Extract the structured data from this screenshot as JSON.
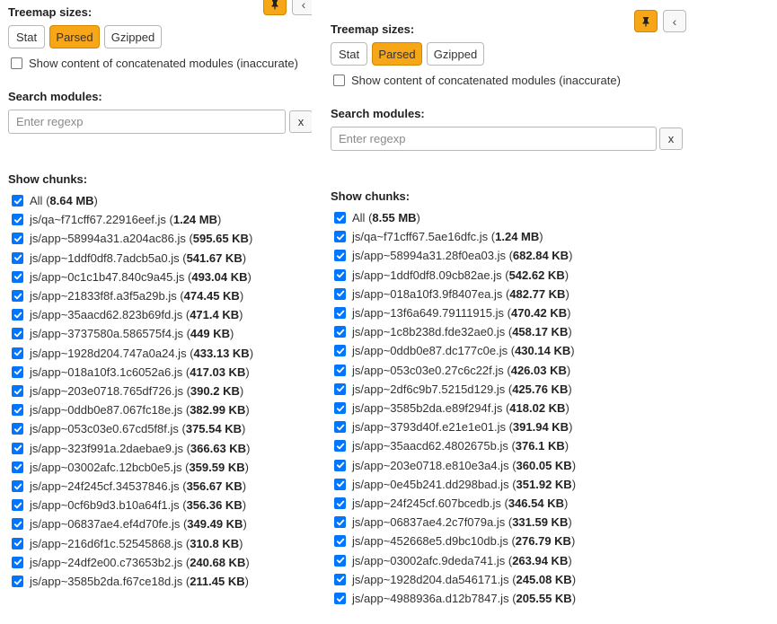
{
  "left": {
    "treemap_title": "Treemap sizes:",
    "size_buttons": [
      {
        "label": "Stat",
        "active": false
      },
      {
        "label": "Parsed",
        "active": true
      },
      {
        "label": "Gzipped",
        "active": false
      }
    ],
    "concat_label": "Show content of concatenated modules (inaccurate)",
    "search_title": "Search modules:",
    "search_placeholder": "Enter regexp",
    "clear_label": "x",
    "chunks_title": "Show chunks:",
    "chunks": [
      {
        "name": "All",
        "size": "8.64 MB"
      },
      {
        "name": "js/qa~f71cff67.22916eef.js",
        "size": "1.24 MB"
      },
      {
        "name": "js/app~58994a31.a204ac86.js",
        "size": "595.65 KB"
      },
      {
        "name": "js/app~1ddf0df8.7adcb5a0.js",
        "size": "541.67 KB"
      },
      {
        "name": "js/app~0c1c1b47.840c9a45.js",
        "size": "493.04 KB"
      },
      {
        "name": "js/app~21833f8f.a3f5a29b.js",
        "size": "474.45 KB"
      },
      {
        "name": "js/app~35aacd62.823b69fd.js",
        "size": "471.4 KB"
      },
      {
        "name": "js/app~3737580a.586575f4.js",
        "size": "449 KB"
      },
      {
        "name": "js/app~1928d204.747a0a24.js",
        "size": "433.13 KB"
      },
      {
        "name": "js/app~018a10f3.1c6052a6.js",
        "size": "417.03 KB"
      },
      {
        "name": "js/app~203e0718.765df726.js",
        "size": "390.2 KB"
      },
      {
        "name": "js/app~0ddb0e87.067fc18e.js",
        "size": "382.99 KB"
      },
      {
        "name": "js/app~053c03e0.67cd5f8f.js",
        "size": "375.54 KB"
      },
      {
        "name": "js/app~323f991a.2daebae9.js",
        "size": "366.63 KB"
      },
      {
        "name": "js/app~03002afc.12bcb0e5.js",
        "size": "359.59 KB"
      },
      {
        "name": "js/app~24f245cf.34537846.js",
        "size": "356.67 KB"
      },
      {
        "name": "js/app~0cf6b9d3.b10a64f1.js",
        "size": "356.36 KB"
      },
      {
        "name": "js/app~06837ae4.ef4d70fe.js",
        "size": "349.49 KB"
      },
      {
        "name": "js/app~216d6f1c.52545868.js",
        "size": "310.8 KB"
      },
      {
        "name": "js/app~24df2e00.c73653b2.js",
        "size": "240.68 KB"
      },
      {
        "name": "js/app~3585b2da.f67ce18d.js",
        "size": "211.45 KB"
      }
    ]
  },
  "right": {
    "treemap_title": "Treemap sizes:",
    "size_buttons": [
      {
        "label": "Stat",
        "active": false
      },
      {
        "label": "Parsed",
        "active": true
      },
      {
        "label": "Gzipped",
        "active": false
      }
    ],
    "concat_label": "Show content of concatenated modules (inaccurate)",
    "search_title": "Search modules:",
    "search_placeholder": "Enter regexp",
    "clear_label": "x",
    "chunks_title": "Show chunks:",
    "chunks": [
      {
        "name": "All",
        "size": "8.55 MB"
      },
      {
        "name": "js/qa~f71cff67.5ae16dfc.js",
        "size": "1.24 MB"
      },
      {
        "name": "js/app~58994a31.28f0ea03.js",
        "size": "682.84 KB"
      },
      {
        "name": "js/app~1ddf0df8.09cb82ae.js",
        "size": "542.62 KB"
      },
      {
        "name": "js/app~018a10f3.9f8407ea.js",
        "size": "482.77 KB"
      },
      {
        "name": "js/app~13f6a649.79111915.js",
        "size": "470.42 KB"
      },
      {
        "name": "js/app~1c8b238d.fde32ae0.js",
        "size": "458.17 KB"
      },
      {
        "name": "js/app~0ddb0e87.dc177c0e.js",
        "size": "430.14 KB"
      },
      {
        "name": "js/app~053c03e0.27c6c22f.js",
        "size": "426.03 KB"
      },
      {
        "name": "js/app~2df6c9b7.5215d129.js",
        "size": "425.76 KB"
      },
      {
        "name": "js/app~3585b2da.e89f294f.js",
        "size": "418.02 KB"
      },
      {
        "name": "js/app~3793d40f.e21e1e01.js",
        "size": "391.94 KB"
      },
      {
        "name": "js/app~35aacd62.4802675b.js",
        "size": "376.1 KB"
      },
      {
        "name": "js/app~203e0718.e810e3a4.js",
        "size": "360.05 KB"
      },
      {
        "name": "js/app~0e45b241.dd298bad.js",
        "size": "351.92 KB"
      },
      {
        "name": "js/app~24f245cf.607bcedb.js",
        "size": "346.54 KB"
      },
      {
        "name": "js/app~06837ae4.2c7f079a.js",
        "size": "331.59 KB"
      },
      {
        "name": "js/app~452668e5.d9bc10db.js",
        "size": "276.79 KB"
      },
      {
        "name": "js/app~03002afc.9deda741.js",
        "size": "263.94 KB"
      },
      {
        "name": "js/app~1928d204.da546171.js",
        "size": "245.08 KB"
      },
      {
        "name": "js/app~4988936a.d12b7847.js",
        "size": "205.55 KB"
      }
    ]
  },
  "icons": {
    "pin": "pin-icon",
    "collapse": "chevron-left-icon",
    "check": "check-icon"
  }
}
